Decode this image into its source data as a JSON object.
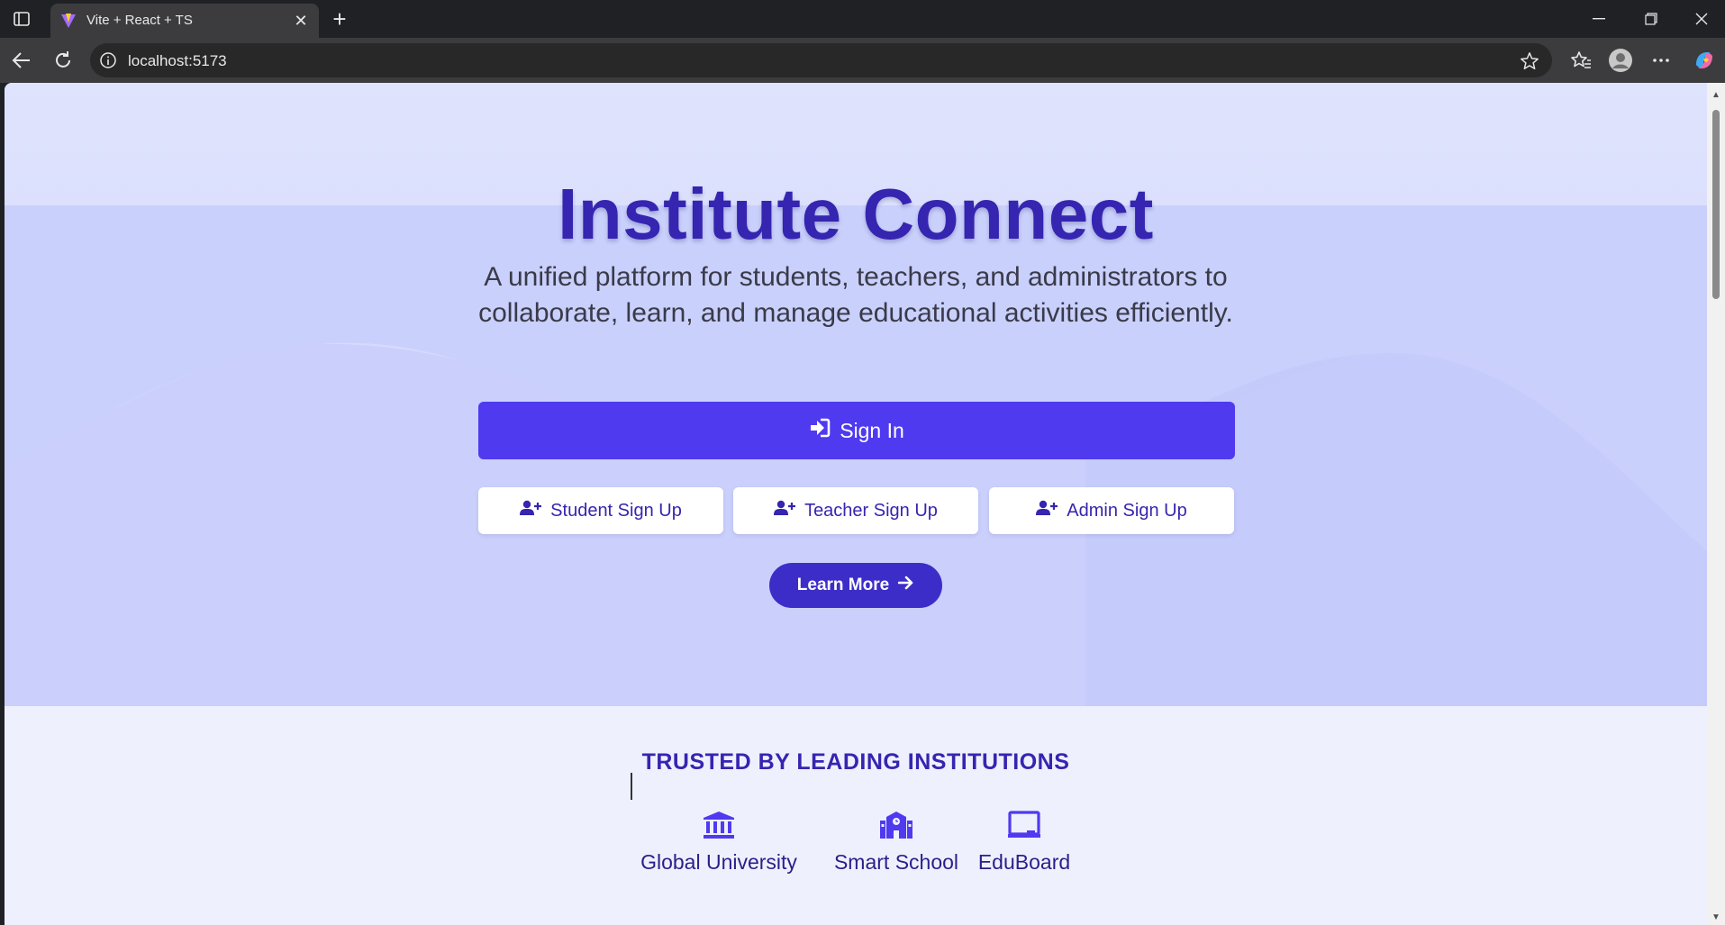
{
  "browser": {
    "tab_title": "Vite + React + TS",
    "url": "localhost:5173"
  },
  "hero": {
    "title": "Institute Connect",
    "subtitle": "A unified platform for students, teachers, and administrators to collaborate, learn, and manage educational activities efficiently.",
    "sign_in_label": "Sign In",
    "signup_buttons": [
      {
        "label": "Student Sign Up"
      },
      {
        "label": "Teacher Sign Up"
      },
      {
        "label": "Admin Sign Up"
      }
    ],
    "learn_more_label": "Learn More"
  },
  "trusted": {
    "title": "TRUSTED BY LEADING INSTITUTIONS",
    "institutions": [
      {
        "name": "Global University",
        "icon": "building-columns-icon"
      },
      {
        "name": "Smart School",
        "icon": "school-icon"
      },
      {
        "name": "EduBoard",
        "icon": "chalkboard-icon"
      }
    ]
  },
  "colors": {
    "primary": "#4f3af0",
    "dark_primary": "#3525b0",
    "hero_bg": "#dfe3fd",
    "section_bg": "#eef0fe"
  }
}
